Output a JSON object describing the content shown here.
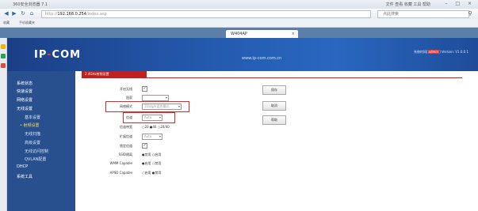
{
  "browser": {
    "title": "360安全浏览器 7.1",
    "menus": "文件 查看 收藏 工具 帮助",
    "address_prefix": "http://",
    "address_host": "192.168.0.254",
    "address_path": "/index.asp",
    "search_placeholder": "点此搜索",
    "tab_label": "W404AP",
    "tab_close": "×",
    "bookmarks": [
      "收藏",
      "手机收藏夹"
    ]
  },
  "banner": {
    "logo_part1": "IP",
    "logo_dash": "-",
    "logo_part2": "COM",
    "site": "www.ip-com.com.cn",
    "version_prefix": "系统时间",
    "version_highlight": "admin",
    "version_suffix": "Version: V1.0.0.1"
  },
  "sidebar": {
    "items": [
      "系统状态",
      "快速设置",
      "网络设置",
      "无线设置",
      "基本设置",
      "射频设置",
      "无线扫描",
      "高级设置",
      "无线访问控制",
      "QVLAN配置",
      "DHCP",
      "系统工具"
    ]
  },
  "content": {
    "section_title": "2.4GHz射频设置",
    "labels": {
      "enable": "开启无线",
      "country": "国家",
      "mode": "网络模式",
      "channel": "信道",
      "bandwidth": "信道带宽",
      "ext_channel": "扩展信道",
      "lock": "锁定信道",
      "ssid_isolation": "SSID隔离",
      "wmm": "WMM Capable",
      "apsd": "APSD Capable"
    },
    "enable_checked": "✓",
    "lock_checked": "✓",
    "country_value": "",
    "mode_value": "11b/g/n混合模式",
    "channel_value": "Auto",
    "ext_channel_value": "Auto",
    "bandwidth_options": "○20  ●40  ○20/40",
    "ssid_isolation_options": "●禁用  ○启用",
    "wmm_options": "●启用  ○禁用",
    "apsd_options": "○启用  ●禁用",
    "buttons": [
      "保存",
      "取消",
      "帮助"
    ]
  }
}
